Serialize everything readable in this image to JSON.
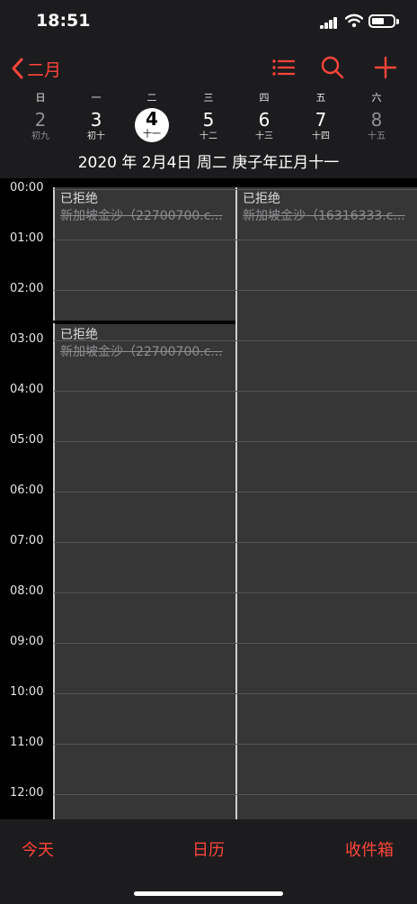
{
  "status_bar": {
    "time": "18:51"
  },
  "nav": {
    "back_label": "二月",
    "icons": [
      "list-icon",
      "search-icon",
      "add-icon"
    ],
    "accent_color": "#ff453a"
  },
  "week": {
    "weekday_labels": [
      "日",
      "一",
      "二",
      "三",
      "四",
      "五",
      "六"
    ],
    "days": [
      {
        "num": "2",
        "lunar": "初九"
      },
      {
        "num": "3",
        "lunar": "初十"
      },
      {
        "num": "4",
        "lunar": "十一"
      },
      {
        "num": "5",
        "lunar": "十二"
      },
      {
        "num": "6",
        "lunar": "十三"
      },
      {
        "num": "7",
        "lunar": "十四"
      },
      {
        "num": "8",
        "lunar": "十五"
      }
    ],
    "selected_day": "4"
  },
  "full_date": "2020 年 2月4日 周二   庚子年正月十一",
  "hours": [
    "00:00",
    "01:00",
    "02:00",
    "03:00",
    "04:00",
    "05:00",
    "06:00",
    "07:00",
    "08:00",
    "09:00",
    "10:00",
    "11:00",
    "12:00"
  ],
  "events": [
    {
      "status": "已拒绝",
      "title": "新加坡金沙（22700700.c..."
    },
    {
      "status": "已拒绝",
      "title": "新加坡金沙（16316333.c..."
    },
    {
      "status": "已拒绝",
      "title": "新加坡金沙（22700700.c..."
    }
  ],
  "tabs": {
    "today": "今天",
    "calendars": "日历",
    "inbox": "收件箱"
  }
}
